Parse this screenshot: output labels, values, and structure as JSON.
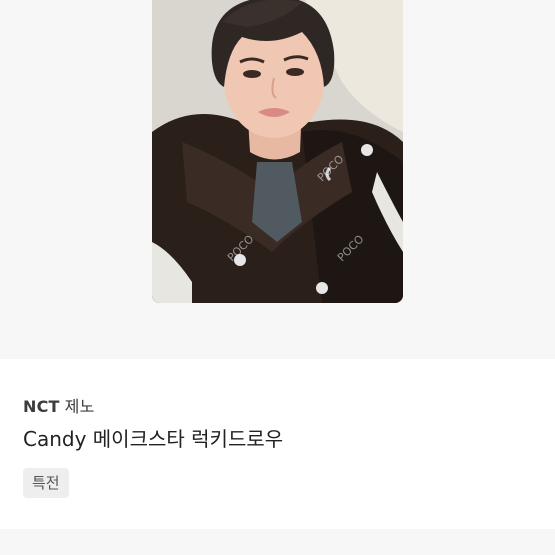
{
  "product": {
    "image_alt": "NCT 제노 Candy 메이크스타 럭키드로우 photocard",
    "watermark": "POCO",
    "artist": "NCT",
    "member": "제노",
    "title": "Candy 메이크스타 럭키드로우",
    "tag": "특전"
  }
}
